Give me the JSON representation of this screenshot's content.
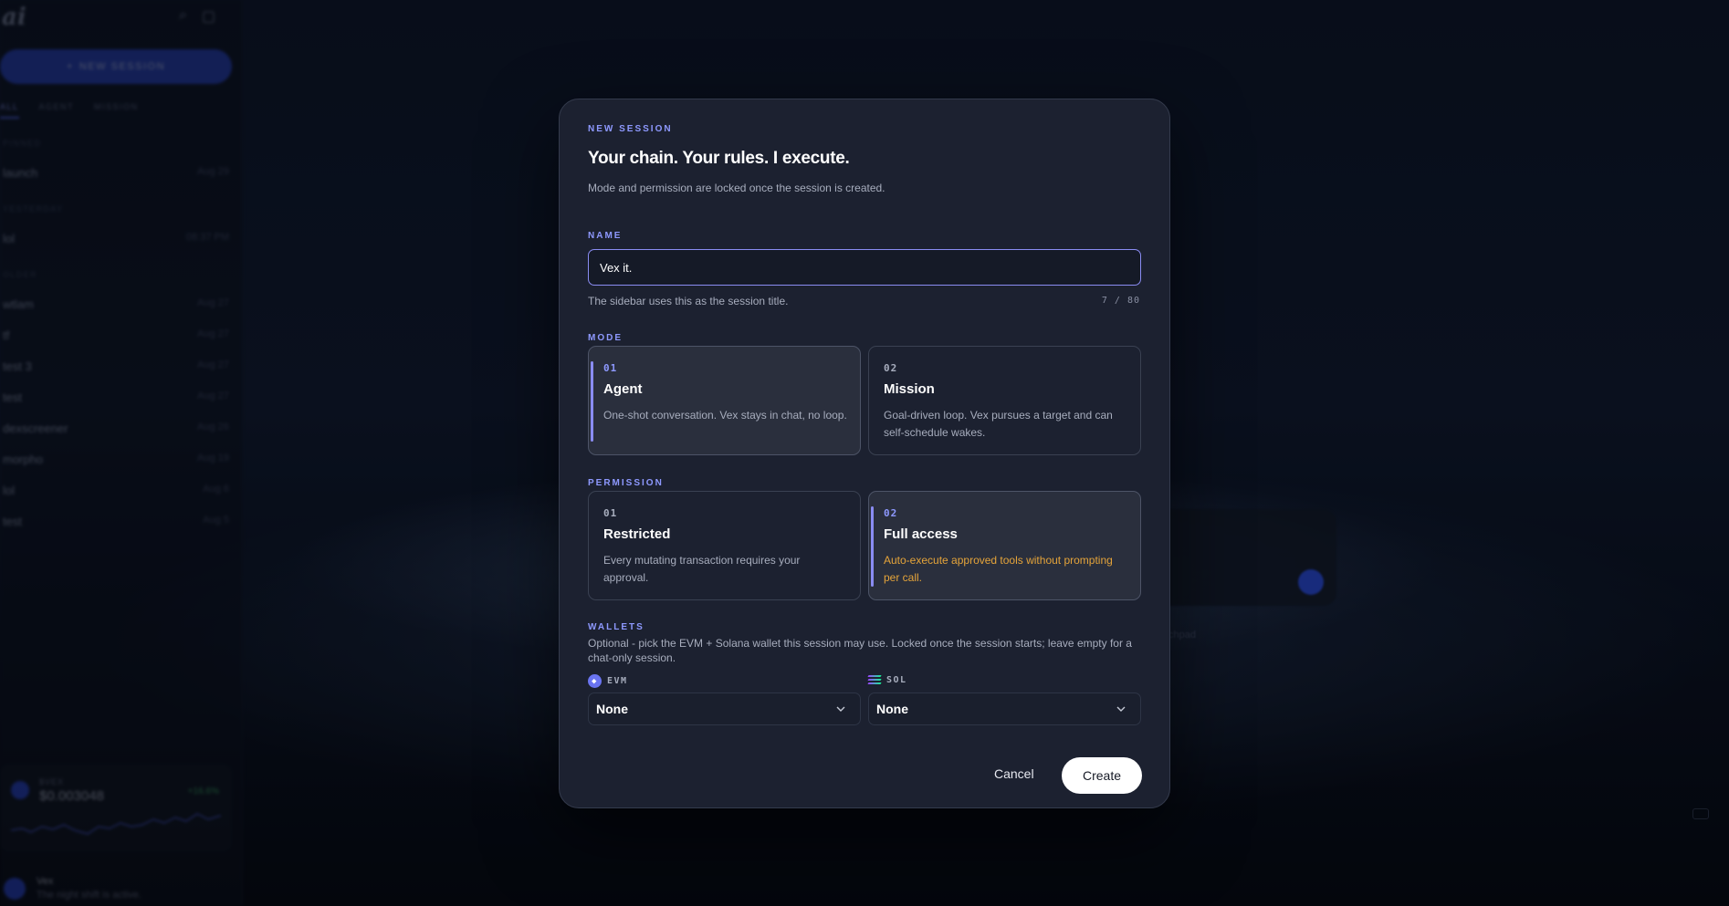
{
  "sidebar": {
    "logo": "ai",
    "new_session_label": "NEW SESSION",
    "tabs": [
      "ALL",
      "AGENT",
      "MISSION"
    ],
    "groups": {
      "pinned": "PINNED",
      "yesterday": "YESTERDAY",
      "older": "OLDER"
    },
    "pinned_items": [
      {
        "label": "launch",
        "date": "Aug 29"
      }
    ],
    "yesterday_items": [
      {
        "label": "lol",
        "date": "08:37 PM"
      }
    ],
    "older_items": [
      {
        "label": "wtlam",
        "date": "Aug 27"
      },
      {
        "label": "tf",
        "date": "Aug 27"
      },
      {
        "label": "test 3",
        "date": "Aug 27"
      },
      {
        "label": "test",
        "date": "Aug 27"
      },
      {
        "label": "dexscreener",
        "date": "Aug 26"
      },
      {
        "label": "morpho",
        "date": "Aug 19"
      },
      {
        "label": "lol",
        "date": "Aug 6"
      },
      {
        "label": "test",
        "date": "Aug 5"
      }
    ],
    "price": {
      "symbol": "$VEX",
      "value": "$0.003048",
      "change": "+16.6%"
    },
    "user": {
      "name": "Vex",
      "status": "The night shift is active."
    }
  },
  "background": {
    "hint": "chpad"
  },
  "modal": {
    "eyebrow": "NEW SESSION",
    "title": "Your chain. Your rules. I execute.",
    "subtitle": "Mode and permission are locked once the session is created.",
    "name": {
      "label": "NAME",
      "value": "Vex it.",
      "help": "The sidebar uses this as the session title.",
      "count": "7 / 80"
    },
    "mode": {
      "label": "MODE",
      "options": [
        {
          "num": "01",
          "title": "Agent",
          "desc": "One-shot conversation. Vex stays in chat, no loop.",
          "selected": true
        },
        {
          "num": "02",
          "title": "Mission",
          "desc": "Goal-driven loop. Vex pursues a target and can self-schedule wakes.",
          "selected": false
        }
      ]
    },
    "permission": {
      "label": "PERMISSION",
      "options": [
        {
          "num": "01",
          "title": "Restricted",
          "desc": "Every mutating transaction requires your approval.",
          "selected": false
        },
        {
          "num": "02",
          "title": "Full access",
          "desc": "Auto-execute approved tools without prompting per call.",
          "selected": true
        }
      ]
    },
    "wallets": {
      "label": "WALLETS",
      "subtitle": "Optional - pick the EVM + Solana wallet this session may use. Locked once the session starts; leave empty for a chat-only session.",
      "evm": {
        "label": "EVM",
        "value": "None",
        "icon": "ethereum-icon"
      },
      "sol": {
        "label": "SOL",
        "value": "None",
        "icon": "solana-icon"
      }
    },
    "actions": {
      "cancel": "Cancel",
      "create": "Create"
    }
  },
  "colors": {
    "accent": "#8a8cf2",
    "warning": "#e5a43a",
    "modal_bg": "#1c2130"
  }
}
